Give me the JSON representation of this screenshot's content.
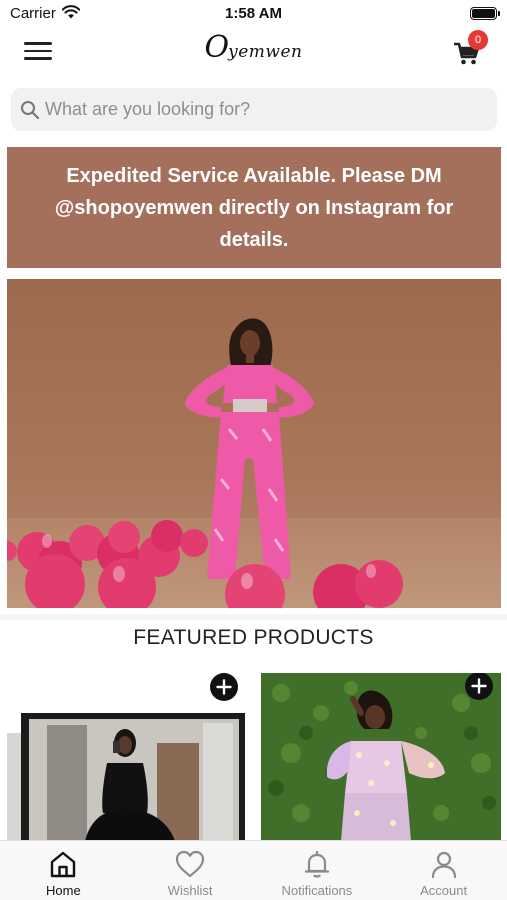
{
  "status_bar": {
    "carrier": "Carrier",
    "time": "1:58 AM"
  },
  "header": {
    "logo_initial": "O",
    "logo_rest": "yemwen",
    "cart_count": "0"
  },
  "search": {
    "placeholder": "What are you looking for?"
  },
  "promo": {
    "text": "Expedited Service Available. Please DM @shopoyemwen directly on Instagram for details."
  },
  "featured": {
    "title": "FEATURED PRODUCTS"
  },
  "tabs": [
    {
      "label": "Home",
      "icon": "home-icon",
      "active": true
    },
    {
      "label": "Wishlist",
      "icon": "heart-icon",
      "active": false
    },
    {
      "label": "Notifications",
      "icon": "bell-icon",
      "active": false
    },
    {
      "label": "Account",
      "icon": "user-icon",
      "active": false
    }
  ],
  "colors": {
    "promo_bg": "#a4705b",
    "badge": "#e53935",
    "outfit_pink": "#ef5aa8",
    "balloon_pink": "#e23b6e"
  }
}
